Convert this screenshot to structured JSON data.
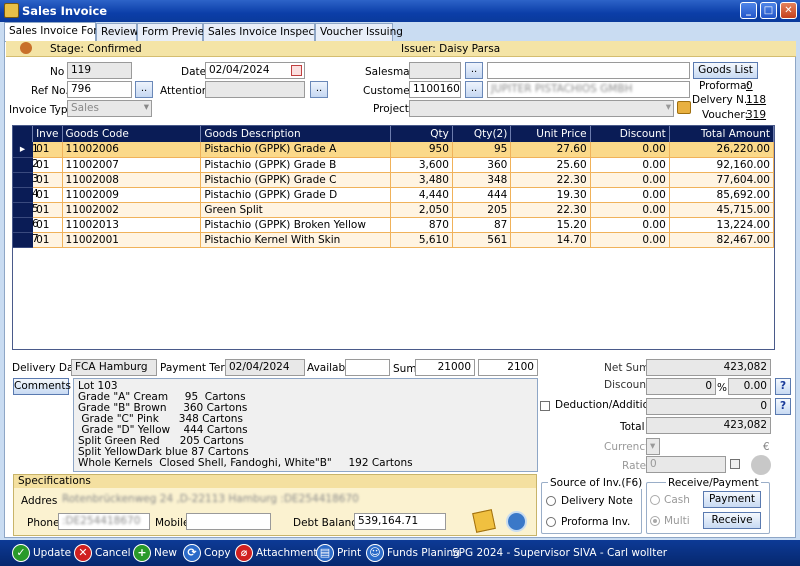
{
  "window": {
    "title": "Sales Invoice"
  },
  "tabs": [
    "Sales Invoice Form",
    "Review",
    "Form Preview",
    "Sales Invoice Inspection",
    "Voucher Issuing"
  ],
  "stage": {
    "stage": "Stage: Confirmed",
    "issuer": "Issuer: Daisy Parsa"
  },
  "header": {
    "no_label": "No",
    "no_value": "119",
    "ref_label": "Ref No.",
    "ref_value": "796",
    "invoice_type_label": "Invoice Type",
    "invoice_type_value": "Sales",
    "date_label": "Date",
    "date_value": "02/04/2024",
    "attention_label": "Attention",
    "attention_value": "",
    "salesman_label": "Salesman",
    "salesman_value": "",
    "customer_label": "Customer",
    "customer_code": "1100160",
    "customer_name": "JUPITER PISTACHIOS GMBH",
    "project_label": "Project",
    "project_value": "",
    "goods_list": "Goods List",
    "proforma_label": "Proforma:",
    "proforma_value": "0",
    "delivery_label": "Delvery N.:",
    "delivery_value": "118",
    "voucher_label": "Voucher:",
    "voucher_value": "319"
  },
  "grid": {
    "columns": [
      "Inve",
      "Goods Code",
      "Goods Description",
      "Qty",
      "Qty(2)",
      "Unit Price",
      "Discount",
      "Total Amount"
    ],
    "rows": [
      {
        "n": "1",
        "inv": "01",
        "code": "11002006",
        "desc": "Pistachio (GPPK) Grade A",
        "qty": "950",
        "qty2": "95",
        "price": "27.60",
        "disc": "0.00",
        "total": "26,220.00"
      },
      {
        "n": "2",
        "inv": "01",
        "code": "11002007",
        "desc": "Pistachio (GPPK) Grade B",
        "qty": "3,600",
        "qty2": "360",
        "price": "25.60",
        "disc": "0.00",
        "total": "92,160.00"
      },
      {
        "n": "3",
        "inv": "01",
        "code": "11002008",
        "desc": "Pistachio (GPPK) Grade C",
        "qty": "3,480",
        "qty2": "348",
        "price": "22.30",
        "disc": "0.00",
        "total": "77,604.00"
      },
      {
        "n": "4",
        "inv": "01",
        "code": "11002009",
        "desc": "Pistachio (GPPK) Grade D",
        "qty": "4,440",
        "qty2": "444",
        "price": "19.30",
        "disc": "0.00",
        "total": "85,692.00"
      },
      {
        "n": "5",
        "inv": "01",
        "code": "11002002",
        "desc": "Green Split",
        "qty": "2,050",
        "qty2": "205",
        "price": "22.30",
        "disc": "0.00",
        "total": "45,715.00"
      },
      {
        "n": "6",
        "inv": "01",
        "code": "11002013",
        "desc": "Pistachio (GPPK) Broken Yellow",
        "qty": "870",
        "qty2": "87",
        "price": "15.20",
        "disc": "0.00",
        "total": "13,224.00"
      },
      {
        "n": "7",
        "inv": "01",
        "code": "11002001",
        "desc": "Pistachio Kernel With Skin",
        "qty": "5,610",
        "qty2": "561",
        "price": "14.70",
        "disc": "0.00",
        "total": "82,467.00"
      }
    ]
  },
  "footer": {
    "delivery_date_label": "Delivery Date",
    "delivery_date_value": "FCA Hamburg",
    "payment_term_label": "Payment Term",
    "payment_term_value": "02/04/2024",
    "available_label": "Available",
    "available_value": "",
    "sum_label": "Sum",
    "sum_qty": "21000",
    "sum_qty2": "2100",
    "comments_button": "Comments",
    "comments_text": "Lot 103\nGrade \"A\" Cream     95  Cartons\nGrade \"B\" Brown     360 Cartons\n Grade \"C\" Pink      348 Cartons\n Grade \"D\" Yellow    444 Cartons\nSplit Green Red      205 Cartons\nSplit YellowDark blue 87 Cartons\nWhole Kernels  Closed Shell, Fandoghi, White\"B\"     192 Cartons",
    "net_sum_label": "Net Sum",
    "net_sum_value": "423,082",
    "discount_label": "Discount",
    "discount_pct": "0",
    "pct_sign": "%",
    "discount_value": "0.00",
    "deduction_label": "Deduction/Additions",
    "deduction_value": "0",
    "total_label": "Total",
    "total_value": "423,082",
    "currency_label": "Currency",
    "currency_symbol": "€",
    "rate_label": "Rate",
    "rate_value": "0",
    "help": "?"
  },
  "source_inv": {
    "title": "Source of Inv.(F6)",
    "delivery_note": "Delivery Note",
    "proforma": "Proforma Inv."
  },
  "receive_payment": {
    "title": "Receive/Payment",
    "cash": "Cash",
    "multi": "Multi",
    "payment_btn": "Payment",
    "receive_btn": "Receive"
  },
  "specs": {
    "title": "Specifications",
    "address_label": "Address",
    "address_value": "Rotenbrückenweg 24 ,D-22113  Hamburg :DE254418670",
    "phone_label": "Phone",
    "phone_value": ":DE254418670",
    "mobile_label": "Mobile",
    "mobile_value": "",
    "debt_label": "Debt Balance",
    "debt_value": "539,164.71"
  },
  "toolbar": {
    "update": "Update",
    "cancel": "Cancel",
    "new": "New",
    "copy": "Copy",
    "attachment": "Attachment",
    "print": "Print",
    "funds": "Funds Planing",
    "status": "SPG 2024 - Supervisor SIVA - Carl wollter"
  },
  "colors": {
    "accent": "#0a1c56",
    "selected_row": "#fbd98a",
    "stage_bar": "#f4e4a6"
  }
}
